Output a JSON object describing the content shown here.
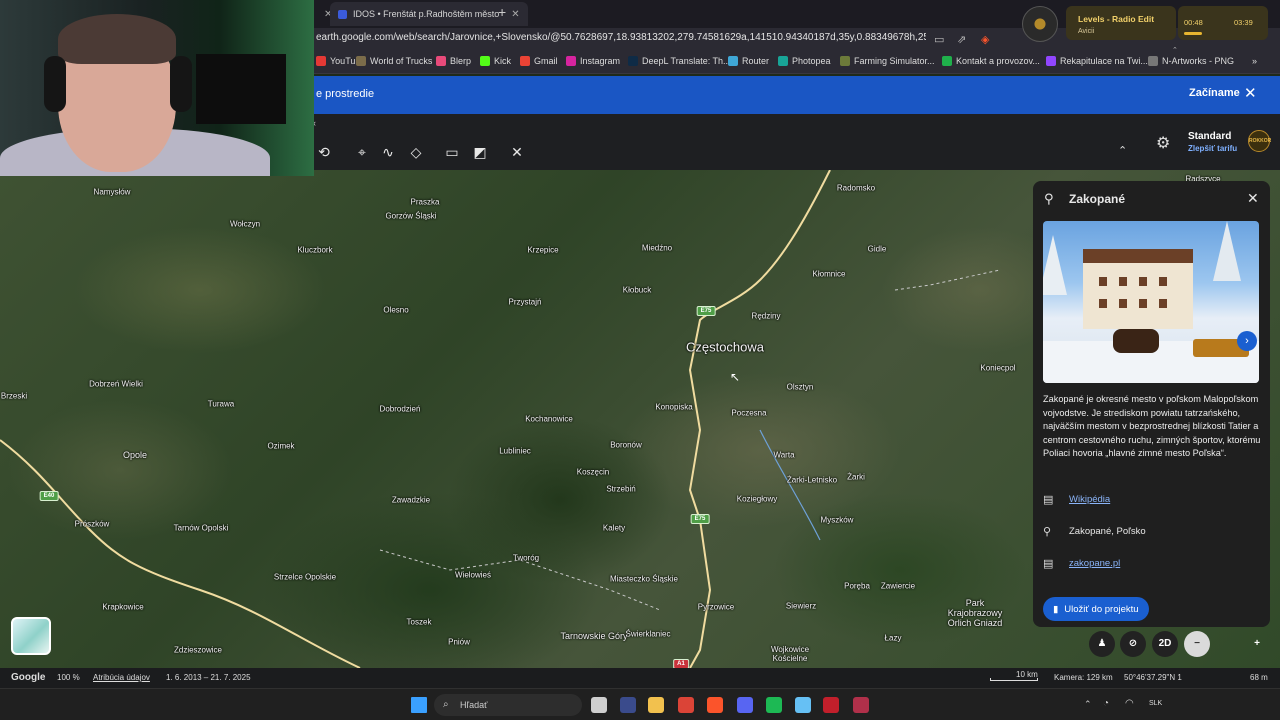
{
  "browser": {
    "tabs": [
      {
        "label": "IDOS • Frenštát p.Radhoštěm město"
      }
    ],
    "url": "earth.google.com/web/search/Jarovnice,+Slovensko/@50.7628697,18.93813202,279.74581629a,141510.94340187d,35y,0.88349678h,25.20654544t,-0...",
    "bookmarks": [
      {
        "label": "YouTube",
        "color": "#e53935"
      },
      {
        "label": "World of Trucks",
        "color": "#7b6c4a"
      },
      {
        "label": "Blerp",
        "color": "#e84a7a"
      },
      {
        "label": "Kick",
        "color": "#53fc18"
      },
      {
        "label": "Gmail",
        "color": "#ea4335"
      },
      {
        "label": "Instagram",
        "color": "#d6249f"
      },
      {
        "label": "DeepL Translate: Th...",
        "color": "#0f2b46"
      },
      {
        "label": "Router",
        "color": "#3fa7d6"
      },
      {
        "label": "Photopea",
        "color": "#18a497"
      },
      {
        "label": "Farming Simulator...",
        "color": "#6c7a3a"
      },
      {
        "label": "Kontakt a provozov...",
        "color": "#1fb04b"
      },
      {
        "label": "Rekapitulace na Twi...",
        "color": "#9146ff"
      },
      {
        "label": "N-Artworks - PNG",
        "color": "#777777"
      }
    ]
  },
  "banner": {
    "message": "e prostredie",
    "action": "Začíname"
  },
  "plan": {
    "name": "Standard",
    "upgrade": "Zlepšiť tarifu",
    "avatar_text": "ROKKOR"
  },
  "map": {
    "places": [
      {
        "name": "Namysłów",
        "size": "small"
      },
      {
        "name": "Praszka",
        "size": "small"
      },
      {
        "name": "Gorzów Śląski",
        "size": "small"
      },
      {
        "name": "Wołczyn",
        "size": "small"
      },
      {
        "name": "Kluczbork",
        "size": "small"
      },
      {
        "name": "Krzepice",
        "size": "small"
      },
      {
        "name": "Miedźno",
        "size": "small"
      },
      {
        "name": "Radomsko",
        "size": "small"
      },
      {
        "name": "Gidle",
        "size": "small"
      },
      {
        "name": "Kłomnice",
        "size": "small"
      },
      {
        "name": "Kłobuck",
        "size": "small"
      },
      {
        "name": "Przystajń",
        "size": "small"
      },
      {
        "name": "Olesno",
        "size": "small"
      },
      {
        "name": "Rędziny",
        "size": "small"
      },
      {
        "name": "Częstochowa",
        "size": "big"
      },
      {
        "name": "Dobrzeń Wielki",
        "size": "small"
      },
      {
        "name": "Brzeski",
        "size": "small"
      },
      {
        "name": "Turawa",
        "size": "small"
      },
      {
        "name": "Dobrodzień",
        "size": "small"
      },
      {
        "name": "Kochanowice",
        "size": "small"
      },
      {
        "name": "Konopiska",
        "size": "small"
      },
      {
        "name": "Poczesna",
        "size": "small"
      },
      {
        "name": "Olsztyn",
        "size": "small"
      },
      {
        "name": "Koniecpol",
        "size": "small"
      },
      {
        "name": "Ozimek",
        "size": "small"
      },
      {
        "name": "Opole",
        "size": "mid"
      },
      {
        "name": "Lubliniec",
        "size": "small"
      },
      {
        "name": "Boronów",
        "size": "small"
      },
      {
        "name": "Warta",
        "size": "small"
      },
      {
        "name": "Koszęcin",
        "size": "small"
      },
      {
        "name": "Żarki-Letnisko",
        "size": "small"
      },
      {
        "name": "Żarki",
        "size": "small"
      },
      {
        "name": "Strzebiń",
        "size": "small"
      },
      {
        "name": "Koziegłowy",
        "size": "small"
      },
      {
        "name": "Zawadzkie",
        "size": "small"
      },
      {
        "name": "Prószków",
        "size": "small"
      },
      {
        "name": "Tarnów Opolski",
        "size": "small"
      },
      {
        "name": "Kalety",
        "size": "small"
      },
      {
        "name": "Myszków",
        "size": "small"
      },
      {
        "name": "Tworóg",
        "size": "small"
      },
      {
        "name": "Strzelce Opolskie",
        "size": "small"
      },
      {
        "name": "Wielowieś",
        "size": "small"
      },
      {
        "name": "Miasteczko Śląskie",
        "size": "small"
      },
      {
        "name": "Poręba",
        "size": "small"
      },
      {
        "name": "Zawiercie",
        "size": "small"
      },
      {
        "name": "Krapkowice",
        "size": "small"
      },
      {
        "name": "Pyrzowice",
        "size": "small"
      },
      {
        "name": "Siewierz",
        "size": "small"
      },
      {
        "name": "Park Krajobrazowy Orlich Gniazd",
        "size": "mid"
      },
      {
        "name": "Toszek",
        "size": "small"
      },
      {
        "name": "Tarnowskie Góry",
        "size": "mid"
      },
      {
        "name": "Świerklaniec",
        "size": "small"
      },
      {
        "name": "Łazy",
        "size": "small"
      },
      {
        "name": "Zdzieszowice",
        "size": "small"
      },
      {
        "name": "Pniów",
        "size": "small"
      },
      {
        "name": "Wojkowice Kościelne",
        "size": "small"
      },
      {
        "name": "Radszyce",
        "size": "small"
      }
    ],
    "road_badges": [
      {
        "label": "E75",
        "color": "#4f9e47"
      },
      {
        "label": "E40",
        "color": "#4f9e47"
      },
      {
        "label": "E75",
        "color": "#4f9e47"
      },
      {
        "label": "A1",
        "color": "#c9323b"
      }
    ]
  },
  "panel": {
    "title": "Zakopané",
    "description": "Zakopané je okresné mesto v poľskom Malopoľskom vojvodstve. Je strediskom powiatu tatrzańského, najväčším mestom v bezprostrednej blízkosti Tatier a centrom cestovného ruchu, zimných športov, ktorému Poliaci hovoria „hlavné zimné mesto Poľska“.",
    "wiki": "Wikipédia",
    "location": "Zakopané, Poľsko",
    "website": "zakopane.pl",
    "save": "Uložiť do projektu"
  },
  "controls": {
    "mode_2d": "2D"
  },
  "status": {
    "brand": "Google",
    "zoom": "100 %",
    "attribution": "Atribúcia údajov",
    "dates": "1. 6. 2013 – 21. 7. 2025",
    "scale": "10 km",
    "camera": "Kamera: 129 km",
    "coords": "50°46'37.29\"N 1",
    "altitude": "68 m"
  },
  "taskbar": {
    "search": "Hľadať",
    "lang": "SLK",
    "apps": [
      {
        "name": "windows",
        "color": "#3aa0ff"
      },
      {
        "name": "file-explorer",
        "color": "#cfcfcf"
      },
      {
        "name": "terminal",
        "color": "#3a4b8c"
      },
      {
        "name": "folder",
        "color": "#f2c14e"
      },
      {
        "name": "chrome",
        "color": "#db4437"
      },
      {
        "name": "brave",
        "color": "#fb542b"
      },
      {
        "name": "discord",
        "color": "#5865f2"
      },
      {
        "name": "spotify",
        "color": "#1db954"
      },
      {
        "name": "steam",
        "color": "#66c0f4"
      },
      {
        "name": "obs",
        "color": "#c21f2b"
      },
      {
        "name": "record",
        "color": "#b0304a"
      }
    ]
  },
  "music": {
    "song": "Levels - Radio Edit",
    "artist": "Avicii",
    "elapsed": "00:48",
    "total": "03:39",
    "progress": 0.22
  }
}
